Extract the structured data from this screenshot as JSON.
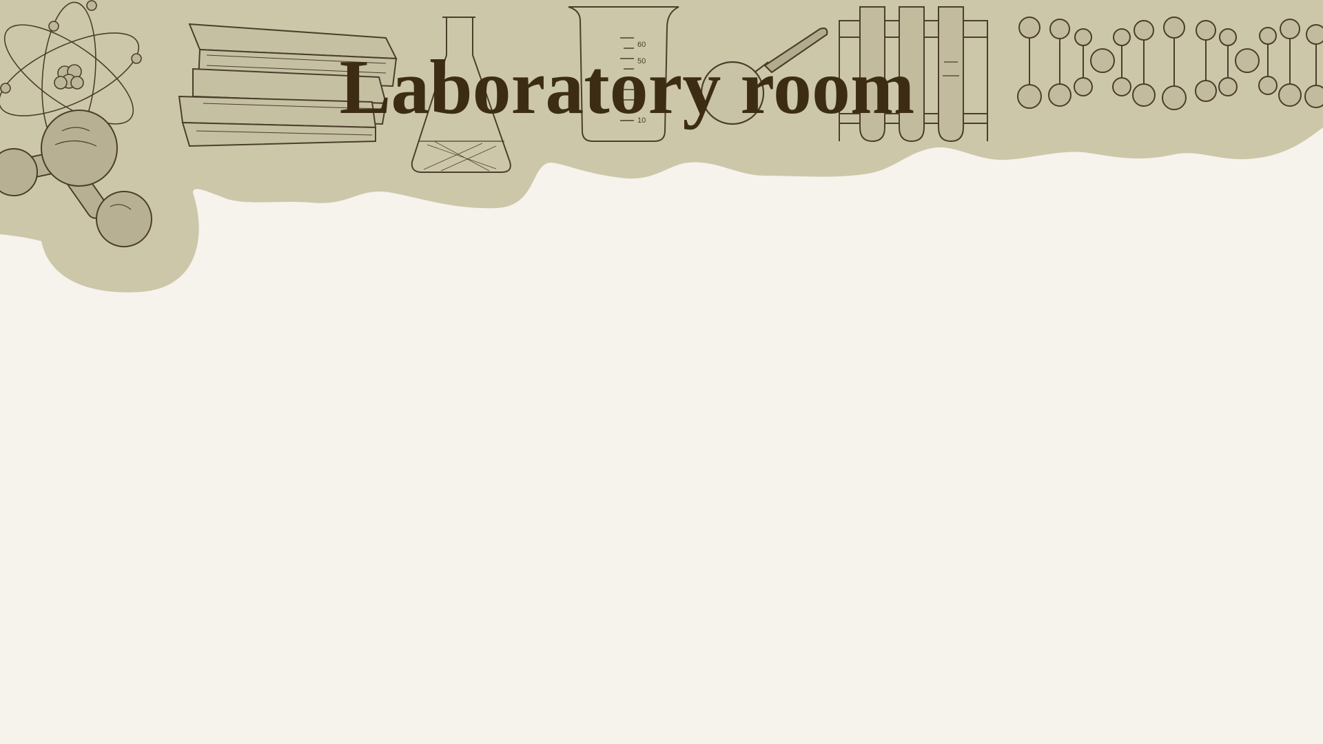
{
  "slide": {
    "title": "Laboratory room"
  },
  "colors": {
    "background": "#f6f2ec",
    "banner": "#ccc7a9",
    "ink": "#4a3d2a",
    "title": "#3d2c14"
  },
  "icons": [
    "atom-icon",
    "molecule-icon",
    "books-icon",
    "erlenmeyer-flask-icon",
    "beaker-icon",
    "magnifying-glass-icon",
    "test-tube-rack-icon",
    "dna-helix-icon"
  ]
}
